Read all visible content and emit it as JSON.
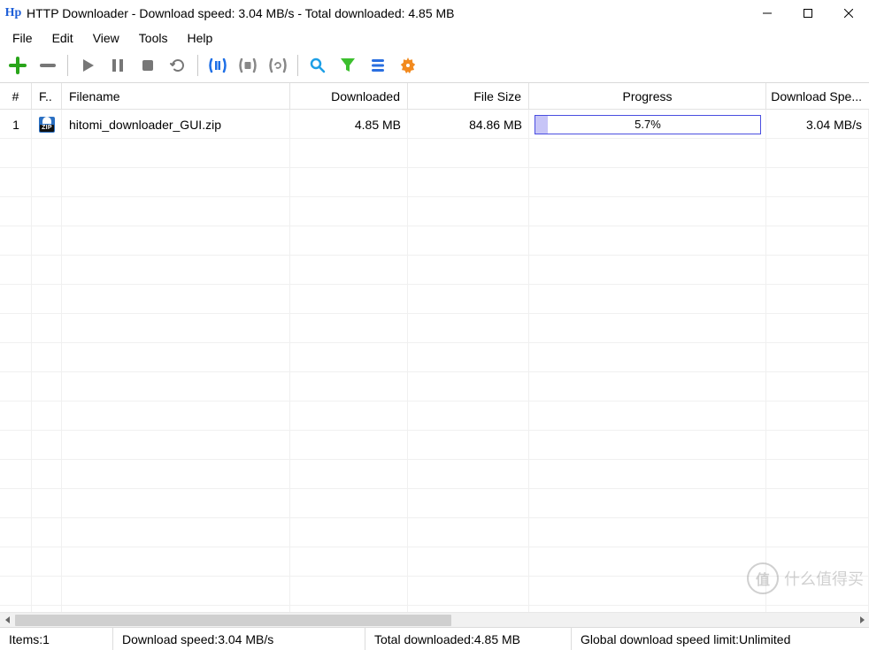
{
  "window": {
    "app_icon_text": "Hp",
    "title": "HTTP Downloader - Download speed: 3.04 MB/s - Total downloaded: 4.85 MB"
  },
  "menu": {
    "items": [
      "File",
      "Edit",
      "View",
      "Tools",
      "Help"
    ]
  },
  "toolbar": {
    "buttons": [
      {
        "name": "add",
        "title": "Add"
      },
      {
        "name": "remove",
        "title": "Remove"
      },
      {
        "sep": true
      },
      {
        "name": "start",
        "title": "Start"
      },
      {
        "name": "pause",
        "title": "Pause"
      },
      {
        "name": "stop",
        "title": "Stop"
      },
      {
        "name": "restart",
        "title": "Restart"
      },
      {
        "sep": true
      },
      {
        "name": "pause-active",
        "title": "Pause Active"
      },
      {
        "name": "stop-all",
        "title": "Stop All"
      },
      {
        "name": "restart-all",
        "title": "Restart All"
      },
      {
        "sep": true
      },
      {
        "name": "search",
        "title": "Search"
      },
      {
        "name": "filter",
        "title": "Filter"
      },
      {
        "name": "queue",
        "title": "Queue"
      },
      {
        "name": "settings",
        "title": "Settings"
      }
    ]
  },
  "columns": {
    "num": "#",
    "type": "F..",
    "name": "Filename",
    "downloaded": "Downloaded",
    "size": "File Size",
    "progress": "Progress",
    "speed": "Download Spe..."
  },
  "rows": [
    {
      "num": "1",
      "type_icon": "zip",
      "type_label": "ZIP",
      "filename": "hitomi_downloader_GUI.zip",
      "downloaded": "4.85 MB",
      "size": "84.86 MB",
      "progress_pct": 5.7,
      "progress_text": "5.7%",
      "speed": "3.04 MB/s"
    }
  ],
  "status": {
    "items_label": "Items: ",
    "items_value": "1",
    "speed_label": "Download speed: ",
    "speed_value": "3.04 MB/s",
    "total_label": "Total downloaded: ",
    "total_value": "4.85 MB",
    "limit_label": "Global download speed limit: ",
    "limit_value": "Unlimited"
  },
  "watermark": {
    "logo": "值",
    "text": "什么值得买"
  }
}
